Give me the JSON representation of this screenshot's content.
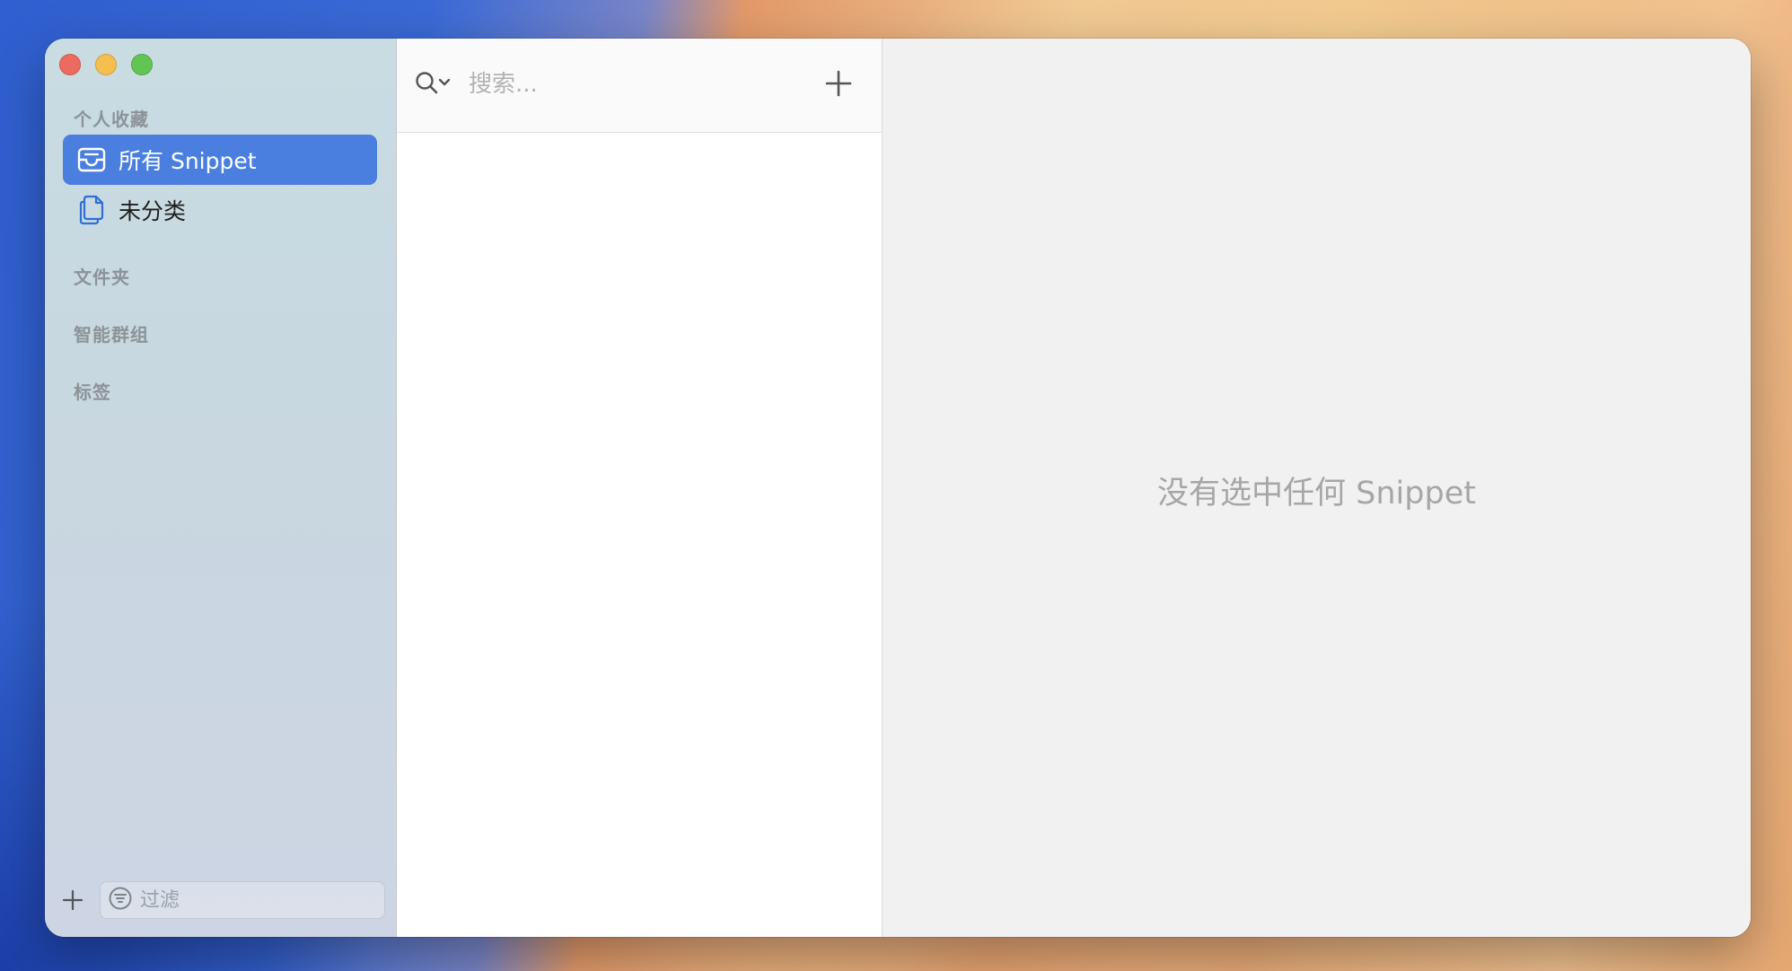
{
  "sidebar": {
    "sections": {
      "favorites": "个人收藏",
      "folders": "文件夹",
      "smart_groups": "智能群组",
      "tags": "标签"
    },
    "items": [
      {
        "label": "所有 Snippet",
        "icon": "tray-icon",
        "selected": true
      },
      {
        "label": "未分类",
        "icon": "documents-icon",
        "selected": false
      }
    ],
    "filter_placeholder": "过滤"
  },
  "list": {
    "search_placeholder": "搜索..."
  },
  "detail": {
    "empty_message": "没有选中任何 Snippet"
  },
  "colors": {
    "accent": "#4a7fe0",
    "icon_blue": "#2f6fd6"
  }
}
